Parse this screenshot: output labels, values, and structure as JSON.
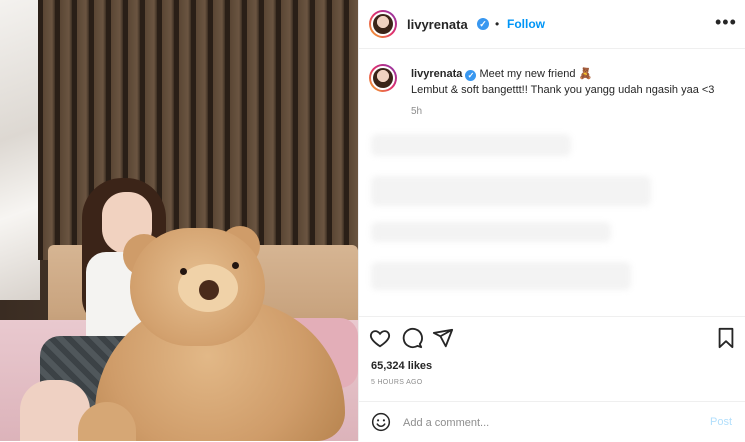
{
  "post": {
    "username": "livyrenata",
    "verified_mark": "✓",
    "dot": "•",
    "follow_label": "Follow",
    "more_icon": "more-horizontal-icon",
    "caption_username": "livyrenata",
    "caption_line1": "Meet my new friend",
    "caption_emoji": "🧸",
    "caption_line2": "Lembut & soft bangettt!! Thank you yangg udah ngasih yaa <3",
    "time_ago": "5h",
    "likes": "65,324 likes",
    "posted": "5 HOURS AGO",
    "comment_placeholder": "Add a comment...",
    "post_label": "Post"
  },
  "icons": {
    "like": "heart-icon",
    "comment": "comment-icon",
    "share": "send-icon",
    "save": "bookmark-icon",
    "emoji": "smiley-icon"
  },
  "colors": {
    "accent": "#0095f6",
    "verified": "#3897f0",
    "post_disabled": "#b2dffc",
    "text": "#262626",
    "muted": "#8e8e8e"
  }
}
